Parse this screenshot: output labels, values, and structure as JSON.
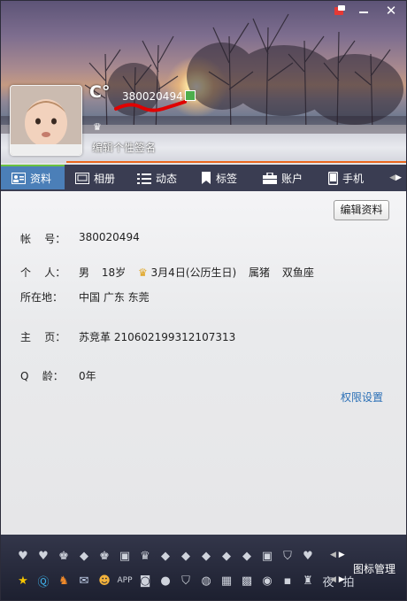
{
  "window": {
    "controls": {
      "skin": "skin-icon",
      "minimize": "—",
      "close": "✕"
    }
  },
  "profile": {
    "nickname": "C°",
    "qq_number": "380020494",
    "signature_placeholder": "编辑个性签名"
  },
  "tabs": [
    {
      "label": "资料",
      "icon": "card-icon",
      "active": true
    },
    {
      "label": "相册",
      "icon": "photo-icon",
      "active": false
    },
    {
      "label": "动态",
      "icon": "feed-icon",
      "active": false
    },
    {
      "label": "标签",
      "icon": "bookmark-icon",
      "active": false
    },
    {
      "label": "账户",
      "icon": "wallet-icon",
      "active": false
    },
    {
      "label": "手机",
      "icon": "phone-icon",
      "active": false
    }
  ],
  "edit_button": "编辑资料",
  "info": {
    "account": {
      "label": "帐    号：",
      "value": "380020494"
    },
    "personal": {
      "label": "个    人：",
      "gender": "男",
      "age": "18岁",
      "birthday": "3月4日(公历生日)",
      "zodiac": "属猪",
      "constellation": "双鱼座"
    },
    "location": {
      "label": "所在地：",
      "value": "中国 广东 东莞"
    },
    "homepage": {
      "label": "主    页：",
      "value": "苏竞革 210602199312107313"
    },
    "qq_age": {
      "label": "Q    龄：",
      "value": "0年"
    }
  },
  "permission_link": "权限设置",
  "icon_manager": "图标管理",
  "colors": {
    "tab_bar": "#3a3d52",
    "active_tab": "#4b7fb8",
    "accent_line": "#e9671e",
    "link": "#2a6fb6"
  }
}
